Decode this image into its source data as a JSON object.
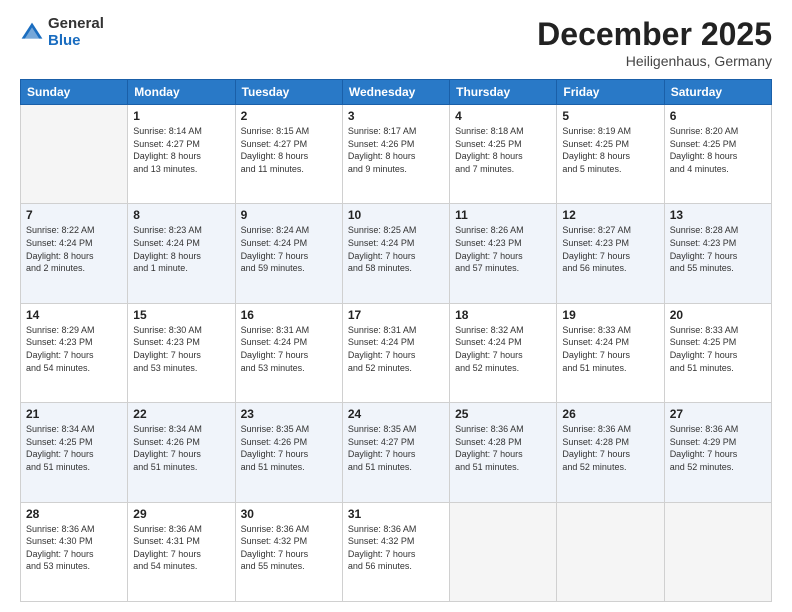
{
  "logo": {
    "general": "General",
    "blue": "Blue"
  },
  "header": {
    "month": "December 2025",
    "location": "Heiligenhaus, Germany"
  },
  "weekdays": [
    "Sunday",
    "Monday",
    "Tuesday",
    "Wednesday",
    "Thursday",
    "Friday",
    "Saturday"
  ],
  "weeks": [
    [
      {
        "day": "",
        "info": ""
      },
      {
        "day": "1",
        "info": "Sunrise: 8:14 AM\nSunset: 4:27 PM\nDaylight: 8 hours\nand 13 minutes."
      },
      {
        "day": "2",
        "info": "Sunrise: 8:15 AM\nSunset: 4:27 PM\nDaylight: 8 hours\nand 11 minutes."
      },
      {
        "day": "3",
        "info": "Sunrise: 8:17 AM\nSunset: 4:26 PM\nDaylight: 8 hours\nand 9 minutes."
      },
      {
        "day": "4",
        "info": "Sunrise: 8:18 AM\nSunset: 4:25 PM\nDaylight: 8 hours\nand 7 minutes."
      },
      {
        "day": "5",
        "info": "Sunrise: 8:19 AM\nSunset: 4:25 PM\nDaylight: 8 hours\nand 5 minutes."
      },
      {
        "day": "6",
        "info": "Sunrise: 8:20 AM\nSunset: 4:25 PM\nDaylight: 8 hours\nand 4 minutes."
      }
    ],
    [
      {
        "day": "7",
        "info": "Sunrise: 8:22 AM\nSunset: 4:24 PM\nDaylight: 8 hours\nand 2 minutes."
      },
      {
        "day": "8",
        "info": "Sunrise: 8:23 AM\nSunset: 4:24 PM\nDaylight: 8 hours\nand 1 minute."
      },
      {
        "day": "9",
        "info": "Sunrise: 8:24 AM\nSunset: 4:24 PM\nDaylight: 7 hours\nand 59 minutes."
      },
      {
        "day": "10",
        "info": "Sunrise: 8:25 AM\nSunset: 4:24 PM\nDaylight: 7 hours\nand 58 minutes."
      },
      {
        "day": "11",
        "info": "Sunrise: 8:26 AM\nSunset: 4:23 PM\nDaylight: 7 hours\nand 57 minutes."
      },
      {
        "day": "12",
        "info": "Sunrise: 8:27 AM\nSunset: 4:23 PM\nDaylight: 7 hours\nand 56 minutes."
      },
      {
        "day": "13",
        "info": "Sunrise: 8:28 AM\nSunset: 4:23 PM\nDaylight: 7 hours\nand 55 minutes."
      }
    ],
    [
      {
        "day": "14",
        "info": "Sunrise: 8:29 AM\nSunset: 4:23 PM\nDaylight: 7 hours\nand 54 minutes."
      },
      {
        "day": "15",
        "info": "Sunrise: 8:30 AM\nSunset: 4:23 PM\nDaylight: 7 hours\nand 53 minutes."
      },
      {
        "day": "16",
        "info": "Sunrise: 8:31 AM\nSunset: 4:24 PM\nDaylight: 7 hours\nand 53 minutes."
      },
      {
        "day": "17",
        "info": "Sunrise: 8:31 AM\nSunset: 4:24 PM\nDaylight: 7 hours\nand 52 minutes."
      },
      {
        "day": "18",
        "info": "Sunrise: 8:32 AM\nSunset: 4:24 PM\nDaylight: 7 hours\nand 52 minutes."
      },
      {
        "day": "19",
        "info": "Sunrise: 8:33 AM\nSunset: 4:24 PM\nDaylight: 7 hours\nand 51 minutes."
      },
      {
        "day": "20",
        "info": "Sunrise: 8:33 AM\nSunset: 4:25 PM\nDaylight: 7 hours\nand 51 minutes."
      }
    ],
    [
      {
        "day": "21",
        "info": "Sunrise: 8:34 AM\nSunset: 4:25 PM\nDaylight: 7 hours\nand 51 minutes."
      },
      {
        "day": "22",
        "info": "Sunrise: 8:34 AM\nSunset: 4:26 PM\nDaylight: 7 hours\nand 51 minutes."
      },
      {
        "day": "23",
        "info": "Sunrise: 8:35 AM\nSunset: 4:26 PM\nDaylight: 7 hours\nand 51 minutes."
      },
      {
        "day": "24",
        "info": "Sunrise: 8:35 AM\nSunset: 4:27 PM\nDaylight: 7 hours\nand 51 minutes."
      },
      {
        "day": "25",
        "info": "Sunrise: 8:36 AM\nSunset: 4:28 PM\nDaylight: 7 hours\nand 51 minutes."
      },
      {
        "day": "26",
        "info": "Sunrise: 8:36 AM\nSunset: 4:28 PM\nDaylight: 7 hours\nand 52 minutes."
      },
      {
        "day": "27",
        "info": "Sunrise: 8:36 AM\nSunset: 4:29 PM\nDaylight: 7 hours\nand 52 minutes."
      }
    ],
    [
      {
        "day": "28",
        "info": "Sunrise: 8:36 AM\nSunset: 4:30 PM\nDaylight: 7 hours\nand 53 minutes."
      },
      {
        "day": "29",
        "info": "Sunrise: 8:36 AM\nSunset: 4:31 PM\nDaylight: 7 hours\nand 54 minutes."
      },
      {
        "day": "30",
        "info": "Sunrise: 8:36 AM\nSunset: 4:32 PM\nDaylight: 7 hours\nand 55 minutes."
      },
      {
        "day": "31",
        "info": "Sunrise: 8:36 AM\nSunset: 4:32 PM\nDaylight: 7 hours\nand 56 minutes."
      },
      {
        "day": "",
        "info": ""
      },
      {
        "day": "",
        "info": ""
      },
      {
        "day": "",
        "info": ""
      }
    ]
  ]
}
